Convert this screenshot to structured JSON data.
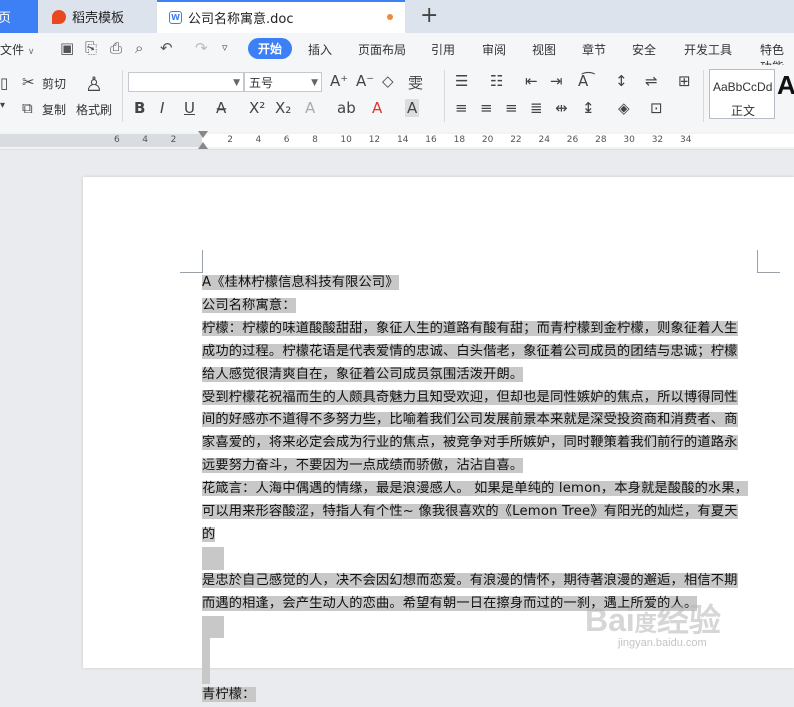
{
  "tabs": [
    {
      "label": "页"
    },
    {
      "label": "稻壳模板"
    },
    {
      "label": "公司名称寓意.doc"
    }
  ],
  "menu": {
    "file": "文件",
    "items": [
      "开始",
      "插入",
      "页面布局",
      "引用",
      "审阅",
      "视图",
      "章节",
      "安全",
      "开发工具",
      "特色功能"
    ]
  },
  "ribbon": {
    "cut": "剪切",
    "copy": "复制",
    "format_painter": "格式刷",
    "font_name": "",
    "font_size": "五号",
    "style_preview": "AaBbCcDd",
    "style_name": "正文",
    "big_style": "A"
  },
  "ruler": [
    "6",
    "4",
    "2",
    "",
    "2",
    "4",
    "6",
    "8",
    "10",
    "12",
    "14",
    "16",
    "18",
    "20",
    "22",
    "24",
    "26",
    "28",
    "30",
    "32",
    "34"
  ],
  "document": {
    "lines": [
      {
        "t": "A《桂林柠檬信息科技有限公司》"
      },
      {
        "t": "公司名称寓意："
      },
      {
        "t": "柠檬：柠檬的味道酸酸甜甜，象征人生的道路有酸有甜；而青柠檬到金柠檬，则象征着人生"
      },
      {
        "t": "成功的过程。柠檬花语是代表爱情的忠诚、白头偕老，象征着公司成员的团结与忠诚；柠檬"
      },
      {
        "t": "给人感觉很清爽自在，象征着公司成员氛围活泼开朗。"
      },
      {
        "t": "受到柠檬花祝福而生的人颇具奇魅力且知受欢迎，但却也是同性嫉妒的焦点，所以博得同性"
      },
      {
        "t": "间的好感亦不道得不多努力些，比喻着我们公司发展前景本来就是深受投资商和消费者、商"
      },
      {
        "t": "家喜爱的，将来必定会成为行业的焦点，被竞争对手所嫉妒，同时鞭策着我们前行的道路永"
      },
      {
        "t": "远要努力奋斗，不要因为一点成绩而骄傲，沾沾自喜。"
      },
      {
        "t": "花箴言：人海中偶遇的情缘，最是浪漫感人。 如果是单纯的 lemon，本身就是酸酸的水果，"
      },
      {
        "t": "可以用来形容酸涩，特指人有个性~ 像我很喜欢的《Lemon Tree》有阳光的灿烂，有夏天"
      },
      {
        "t": "的"
      },
      {
        "t": ""
      },
      {
        "t": "是忠於自己感觉的人，决不会因幻想而恋爱。有浪漫的情怀，期待著浪漫的邂逅，相信不期"
      },
      {
        "t": "而遇的相逢，会产生动人的恋曲。希望有朝一日在擦身而过的一刹，遇上所爱的人。"
      },
      {
        "t": ""
      },
      {
        "t": ""
      },
      {
        "t": ""
      },
      {
        "t": "青柠檬："
      }
    ]
  },
  "watermark": {
    "logo": "Bai 百度 经验",
    "url": "jingyan.baidu.com"
  },
  "colors": {
    "accent": "#3d7ff5",
    "highlight": "#c8c8c8"
  }
}
